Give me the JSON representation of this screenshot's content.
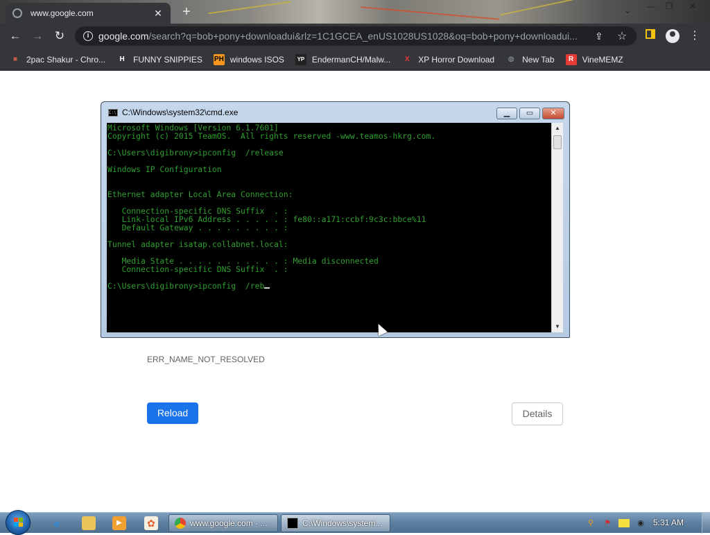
{
  "browser": {
    "tab": {
      "title": "www.google.com",
      "close_glyph": "✕"
    },
    "new_tab_glyph": "+",
    "window_buttons": {
      "minimize": "—",
      "restore": "❐",
      "close": "✕"
    },
    "toolbar": {
      "back_glyph": "←",
      "forward_glyph": "→",
      "reload_glyph": "↻",
      "address": {
        "domain": "google.com",
        "path": "/search?q=bob+pony+downloadui&rlz=1C1GCEA_enUS1028US1028&oq=bob+pony+downloadui..."
      },
      "share_glyph": "⇪",
      "star_glyph": "☆",
      "menu_glyph": "⋮"
    },
    "bookmarks": [
      {
        "label": "2pac Shakur - Chro...",
        "icon": "cart-icon",
        "color": "#d44"
      },
      {
        "label": "FUNNY SNIPPIES",
        "icon": "h-icon",
        "glyph": "H",
        "color": "#ffffff"
      },
      {
        "label": "windows ISOS",
        "icon": "ph-icon",
        "glyph": "PH",
        "color": "#f7971d"
      },
      {
        "label": "EndermanCH/Malw...",
        "icon": "yp-icon",
        "glyph": "YP",
        "color": "#333"
      },
      {
        "label": "XP Horror Download",
        "icon": "x-icon",
        "glyph": "X",
        "color": "#e53935"
      },
      {
        "label": "New Tab",
        "icon": "globe-icon",
        "glyph": "◍",
        "color": "#9aa0a6"
      },
      {
        "label": "VineMEMZ",
        "icon": "r-icon",
        "glyph": "R",
        "color": "#e53935"
      }
    ]
  },
  "page": {
    "error_code": "ERR_NAME_NOT_RESOLVED",
    "reload_label": "Reload",
    "details_label": "Details"
  },
  "cmd": {
    "title": "C:\\Windows\\system32\\cmd.exe",
    "icon_text": "C:\\",
    "buttons": {
      "minimize": "▁",
      "maximize": "▭",
      "close": "✕"
    },
    "lines": [
      "Microsoft Windows [Version 6.1.7601]",
      "Copyright (c) 2015 TeamOS.  All rights reserved -www.teamos-hkrg.com.",
      "",
      "C:\\Users\\digibrony>ipconfig  /release",
      "",
      "Windows IP Configuration",
      "",
      "",
      "Ethernet adapter Local Area Connection:",
      "",
      "   Connection-specific DNS Suffix  . :",
      "   Link-local IPv6 Address . . . . . : fe80::a171:ccbf:9c3c:bbce%11",
      "   Default Gateway . . . . . . . . . :",
      "",
      "Tunnel adapter isatap.collabnet.local:",
      "",
      "   Media State . . . . . . . . . . . : Media disconnected",
      "   Connection-specific DNS Suffix  . :",
      "",
      "C:\\Users\\digibrony>ipconfig  /reb"
    ]
  },
  "taskbar": {
    "tasks": [
      {
        "label": "www.google.com - ...",
        "icon": "chrome-icon"
      },
      {
        "label": "C:\\Windows\\system...",
        "icon": "cmd-icon"
      }
    ],
    "clock": "5:31 AM"
  }
}
